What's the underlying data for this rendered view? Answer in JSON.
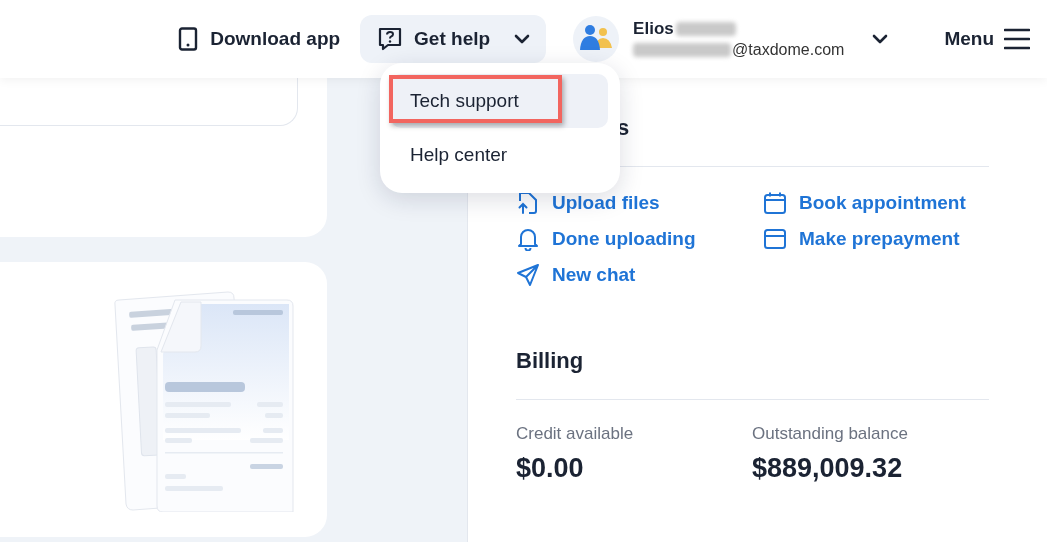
{
  "header": {
    "download_app": "Download app",
    "get_help": {
      "label": "Get help",
      "expanded": true
    },
    "user": {
      "name": "Elios",
      "email": "@taxdome.com"
    },
    "menu": "Menu"
  },
  "help_menu": [
    {
      "label": "Tech support",
      "selected": true,
      "annotated": true
    },
    {
      "label": "Help center",
      "selected": false,
      "annotated": false
    }
  ],
  "actions": {
    "title": "s",
    "items": [
      {
        "label": "Upload files"
      },
      {
        "label": "Done uploading"
      },
      {
        "label": "New chat"
      },
      {
        "label": "Book appointment"
      },
      {
        "label": "Make prepayment"
      }
    ]
  },
  "billing": {
    "title": "Billing",
    "stats": [
      {
        "label": "Credit available",
        "value": "$0.00"
      },
      {
        "label": "Outstanding balance",
        "value": "$889,009.32"
      }
    ]
  }
}
